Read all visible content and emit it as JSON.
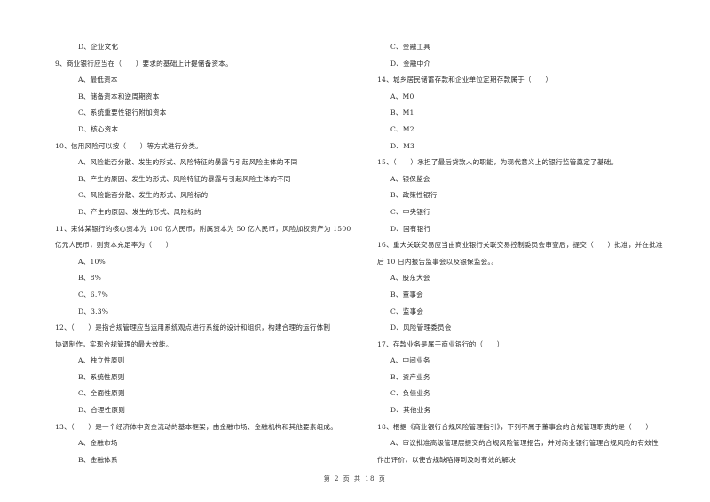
{
  "page": {
    "footer": "第 2 页 共 18 页"
  },
  "left_column": [
    {
      "type": "opt",
      "text": "D、企业文化"
    },
    {
      "type": "q",
      "text": "9、商业银行应当在（　　）要求的基础上计提储备资本。"
    },
    {
      "type": "opt",
      "text": "A、最低资本"
    },
    {
      "type": "opt",
      "text": "B、储备资本和逆周期资本"
    },
    {
      "type": "opt",
      "text": "C、系统重要性银行附加资本"
    },
    {
      "type": "opt",
      "text": "D、核心资本"
    },
    {
      "type": "q",
      "text": "10、信用风险可以按（　　）等方式进行分类。"
    },
    {
      "type": "opt",
      "text": "A、风险能否分散、发生的形式、风险特征的暴露与引起风险主体的不同"
    },
    {
      "type": "opt",
      "text": "B、产生的原因、发生的形式、风险特征的暴露与引起风险主体的不同"
    },
    {
      "type": "opt",
      "text": "C、风险能否分散、发生的形式、风险标的"
    },
    {
      "type": "opt",
      "text": "D、产生的原因、发生的形式、风险标的"
    },
    {
      "type": "q",
      "text": "11、宋体某银行的核心资本为 100 亿人民币，附属资本为 50 亿人民币，风险加权资产为 1500"
    },
    {
      "type": "q-cont",
      "text": "亿元人民币，则资本充足率为（　　）"
    },
    {
      "type": "opt",
      "text": "A、10%"
    },
    {
      "type": "opt",
      "text": "B、8%"
    },
    {
      "type": "opt",
      "text": "C、6.7%"
    },
    {
      "type": "opt",
      "text": "D、3.3%"
    },
    {
      "type": "q",
      "text": "12、（　　）是指合规管理应当运用系统观点进行系统的设计和组织，构建合理的运行体制"
    },
    {
      "type": "q-cont",
      "text": "协调制作，实现合规管理的最大效能。"
    },
    {
      "type": "opt",
      "text": "A、独立性原则"
    },
    {
      "type": "opt",
      "text": "B、系统性原则"
    },
    {
      "type": "opt",
      "text": "C、全面性原则"
    },
    {
      "type": "opt",
      "text": "D、合理性原则"
    },
    {
      "type": "q",
      "text": "13、（　　）是一个经济体中资金流动的基本框架，由金融市场、金融机构和其他要素组成。"
    },
    {
      "type": "opt",
      "text": "A、金融市场"
    },
    {
      "type": "opt",
      "text": "B、金融体系"
    }
  ],
  "right_column": [
    {
      "type": "opt",
      "text": "C、金融工具"
    },
    {
      "type": "opt",
      "text": "D、金融中介"
    },
    {
      "type": "q",
      "text": "14、城乡居民储蓄存款和企业单位定期存款属于（　　）"
    },
    {
      "type": "opt",
      "text": "A、M0"
    },
    {
      "type": "opt",
      "text": "B、M1"
    },
    {
      "type": "opt",
      "text": "C、M2"
    },
    {
      "type": "opt",
      "text": "D、M3"
    },
    {
      "type": "q",
      "text": "15、（　　）承担了最后贷款人的职能，为现代意义上的银行监管奠定了基础。"
    },
    {
      "type": "opt",
      "text": "A、银保监会"
    },
    {
      "type": "opt",
      "text": "B、政策性银行"
    },
    {
      "type": "opt",
      "text": "C、中央银行"
    },
    {
      "type": "opt",
      "text": "D、国有银行"
    },
    {
      "type": "q",
      "text": "16、重大关联交易应当由商业银行关联交易控制委员会审查后，提交（　　）批准，并在批准"
    },
    {
      "type": "q-cont",
      "text": "后 10 日内报告监事会以及银保监会。。"
    },
    {
      "type": "opt",
      "text": "A、股东大会"
    },
    {
      "type": "opt",
      "text": "B、董事会"
    },
    {
      "type": "opt",
      "text": "C、监事会"
    },
    {
      "type": "opt",
      "text": "D、风险管理委员会"
    },
    {
      "type": "q",
      "text": "17、存款业务是属于商业银行的（　　）"
    },
    {
      "type": "opt",
      "text": "A、中间业务"
    },
    {
      "type": "opt",
      "text": "B、资产业务"
    },
    {
      "type": "opt",
      "text": "C、负债业务"
    },
    {
      "type": "opt",
      "text": "D、其他业务"
    },
    {
      "type": "q",
      "text": "18、根据《商业银行合规风险管理指引》，下列不属于董事会的合规管理职责的是（　　）"
    },
    {
      "type": "opt",
      "text": "A、审议批准高级管理层提交的合规风险管理报告，并对商业银行管理合规风险的有效性"
    },
    {
      "type": "q-cont",
      "text": "作出评价，以使合规缺陷得到及时有效的解决"
    }
  ]
}
